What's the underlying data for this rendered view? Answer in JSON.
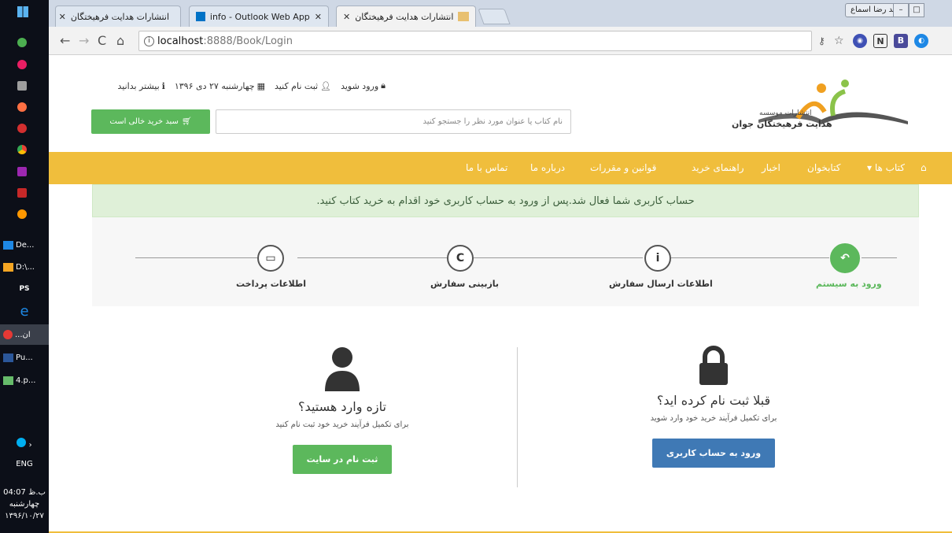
{
  "taskbar": {
    "apps": [
      {
        "label": "De...",
        "color": "#1e88e5"
      },
      {
        "label": "D:\\...",
        "color": "#f5a623"
      },
      {
        "label": "PS",
        "color": "#222"
      },
      {
        "label": "e",
        "color": "#1e88e5"
      },
      {
        "label": "...ان",
        "color": "#e53935"
      },
      {
        "label": "Pu...",
        "color": "#2b579a"
      },
      {
        "label": "4.p...",
        "color": "#66bb6a"
      }
    ],
    "lang": "ENG",
    "time": "04:07 ب.ظ",
    "day": "چهارشنبه",
    "date": "۱۳۹۶/۱۰/۲۷"
  },
  "browser": {
    "tabs": [
      {
        "title": "انتشارات هدایت فرهیختگان",
        "active": false
      },
      {
        "title": "info - Outlook Web App",
        "active": false
      },
      {
        "title": "انتشارات هدایت فرهیختگان",
        "active": true
      }
    ],
    "profile": "محمد رضا اسماع...",
    "url_host": "localhost",
    "url_port_path": ":8888/Book/Login",
    "extensions": [
      "B",
      "N",
      "B"
    ]
  },
  "header": {
    "logo_line1": "انتشارات موسسه",
    "logo_line2": "هدایت فرهیختگان جوان",
    "login": "ورود شوید",
    "register": "ثبت نام کنید",
    "date": "چهارشنبه ۲۷ دی ۱۳۹۶",
    "more": "بیشتر بدانید",
    "search_placeholder": "نام کتاب یا عنوان مورد نظر را جستجو کنید",
    "cart": "سبد خرید خالی است"
  },
  "nav": {
    "items": [
      "کتاب ها",
      "کتابخوان",
      "اخبار",
      "راهنمای خرید",
      "قوانین و مقررات",
      "درباره ما",
      "تماس با ما"
    ]
  },
  "alert": "حساب کاربری شما فعال شد.پس از ورود به حساب کاربری خود اقدام به خرید کتاب کنید.",
  "steps": [
    {
      "label": "ورود به سیستم",
      "icon": "undo-arrow-icon",
      "glyph": "↶"
    },
    {
      "label": "اطلاعات ارسال سفارش",
      "icon": "info-icon",
      "glyph": "i"
    },
    {
      "label": "بازبینی سفارش",
      "icon": "refresh-icon",
      "glyph": "C"
    },
    {
      "label": "اطلاعات پرداخت",
      "icon": "credit-card-icon",
      "glyph": "▭"
    }
  ],
  "login_panel": {
    "title": "قبلا ثبت نام کرده اید؟",
    "text": "برای تکمیل فرآیند خرید خود وارد شوید",
    "button": "ورود به حساب کاربری"
  },
  "register_panel": {
    "title": "تازه وارد هستید؟",
    "text": "برای تکمیل فرآیند خرید خود ثبت نام کنید",
    "button": "ثبت نام در سایت"
  },
  "colors": {
    "nav_bg": "#f0be3c",
    "success": "#5cb85c",
    "primary": "#3f79b5",
    "alert_bg": "#dff0d8"
  }
}
